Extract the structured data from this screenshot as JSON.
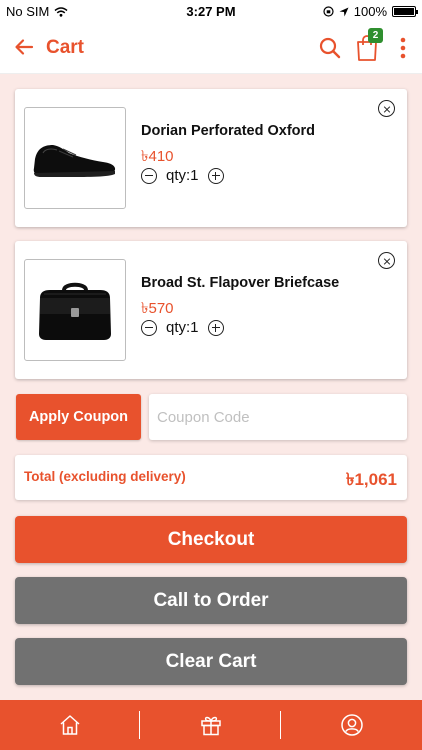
{
  "status_bar": {
    "carrier": "No SIM",
    "time": "3:27 PM",
    "battery": "100%"
  },
  "header": {
    "title": "Cart",
    "cart_badge": "2"
  },
  "cart": {
    "items": [
      {
        "name": "Dorian Perforated Oxford",
        "price": "৳410",
        "qty": "qty:1"
      },
      {
        "name": "Broad St. Flapover Briefcase",
        "price": "৳570",
        "qty": "qty:1"
      }
    ]
  },
  "coupon": {
    "button_label": "Apply Coupon",
    "placeholder": "Coupon Code"
  },
  "total": {
    "label": "Total (excluding delivery)",
    "value": "৳1,061"
  },
  "actions": {
    "checkout": "Checkout",
    "call_to_order": "Call to Order",
    "clear_cart": "Clear Cart"
  },
  "colors": {
    "accent": "#e8522d",
    "secondary_button": "#717171",
    "badge": "#2f8f2f",
    "background": "#fbe9e6"
  },
  "icons": {
    "header": [
      "back-arrow-icon",
      "search-icon",
      "shopping-bag-icon",
      "more-vertical-icon"
    ],
    "bottom_nav": [
      "home-icon",
      "gift-icon",
      "user-icon"
    ]
  }
}
